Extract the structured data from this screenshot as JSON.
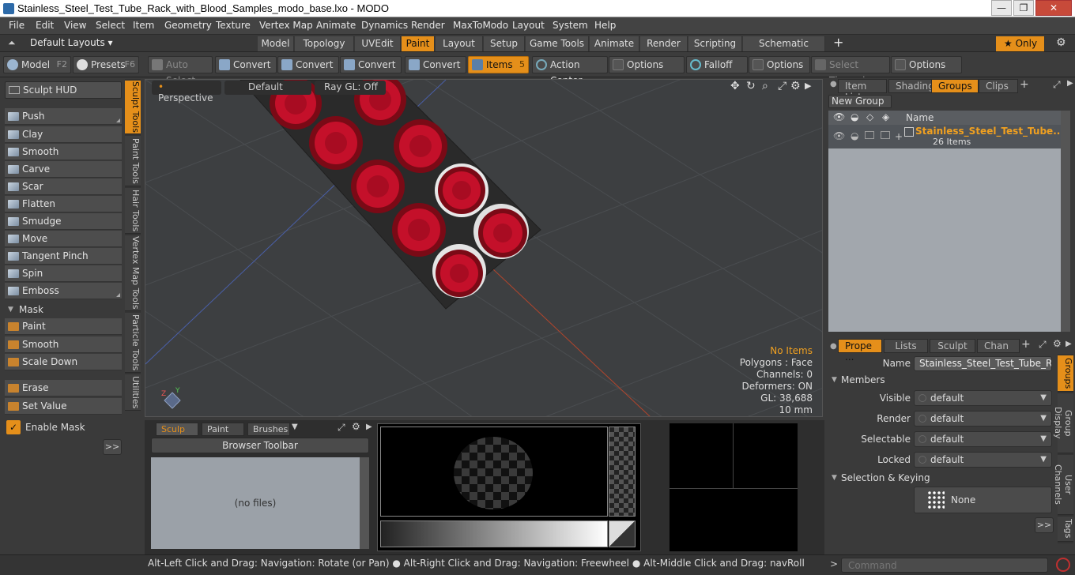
{
  "window": {
    "title": "Stainless_Steel_Test_Tube_Rack_with_Blood_Samples_modo_base.lxo - MODO"
  },
  "menu": [
    "File",
    "Edit",
    "View",
    "Select",
    "Item",
    "Geometry",
    "Texture",
    "Vertex Map",
    "Animate",
    "Dynamics",
    "Render",
    "MaxToModo",
    "Layout",
    "System",
    "Help"
  ],
  "layouts": {
    "default_label": "Default Layouts",
    "tabs": [
      "Model",
      "Topology",
      "UVEdit",
      "Paint",
      "Layout",
      "Setup",
      "Game Tools",
      "Animate",
      "Render",
      "Scripting",
      "Schematic Fusion"
    ],
    "active_tab": "Paint",
    "add": "+",
    "only_label": "Only"
  },
  "toolbar": {
    "model_label": "Model",
    "model_key": "F2",
    "presets_label": "Presets",
    "presets_key": "F6",
    "auto_select": "Auto Select",
    "convert1": "Convert",
    "convert2": "Convert",
    "convert3": "Convert",
    "convert4": "Convert",
    "items": "Items",
    "items_key": "5",
    "action_center": "Action Center",
    "options1": "Options",
    "falloff": "Falloff",
    "options2": "Options",
    "select_through": "Select Through",
    "options3": "Options"
  },
  "left": {
    "hud": "Sculpt HUD",
    "tools": [
      "Push",
      "Clay",
      "Smooth",
      "Carve",
      "Scar",
      "Flatten",
      "Smudge",
      "Move",
      "Tangent Pinch",
      "Spin",
      "Emboss"
    ],
    "mask_header": "Mask",
    "mask_tools": [
      "Paint",
      "Smooth",
      "Scale Down"
    ],
    "erase": "Erase",
    "set_value": "Set Value",
    "enable_mask": "Enable Mask",
    "more": ">>",
    "vtabs": [
      "Sculpt Tools",
      "Paint Tools",
      "Hair Tools",
      "Vertex Map Tools",
      "Particle Tools",
      "Utilities"
    ]
  },
  "viewport": {
    "view": "Perspective",
    "shading": "Default",
    "raygl": "Ray GL: Off",
    "info": {
      "no_items": "No Items",
      "polygons": "Polygons : Face",
      "channels": "Channels: 0",
      "deformers": "Deformers: ON",
      "gl": "GL: 38,688",
      "unit": "10 mm"
    }
  },
  "bottom": {
    "tabs": [
      "Sculp ...",
      "Paint ...",
      "Brushes"
    ],
    "browser_toolbar": "Browser Toolbar",
    "no_files": "(no files)"
  },
  "right_top": {
    "tabs": [
      "Item List",
      "Shading",
      "Groups",
      "Clips"
    ],
    "active": "Groups",
    "new_group": "New Group",
    "col_name": "Name",
    "group_name": "Stainless_Steel_Test_Tube...",
    "group_count": "26 Items"
  },
  "right_bottom": {
    "tabs": [
      "Prope ...",
      "Lists",
      "Sculpt",
      "Chan ..."
    ],
    "active": "Prope ...",
    "name_label": "Name",
    "name_value": "Stainless_Steel_Test_Tube_Rack_v",
    "members": "Members",
    "visible_label": "Visible",
    "visible_value": "default",
    "render_label": "Render",
    "render_value": "default",
    "selectable_label": "Selectable",
    "selectable_value": "default",
    "locked_label": "Locked",
    "locked_value": "default",
    "selection_keying": "Selection & Keying",
    "none_label": "None",
    "more": ">>",
    "vtabs": [
      "Groups",
      "Group Display",
      "User Channels",
      "Tags"
    ]
  },
  "status": {
    "hint": "Alt-Left Click and Drag: Navigation: Rotate (or Pan) ● Alt-Right Click and Drag: Navigation: Freewheel ● Alt-Middle Click and Drag: navRoll",
    "command_placeholder": "Command"
  },
  "colors": {
    "accent": "#e58f1a",
    "cap_red": "#c4102a"
  }
}
